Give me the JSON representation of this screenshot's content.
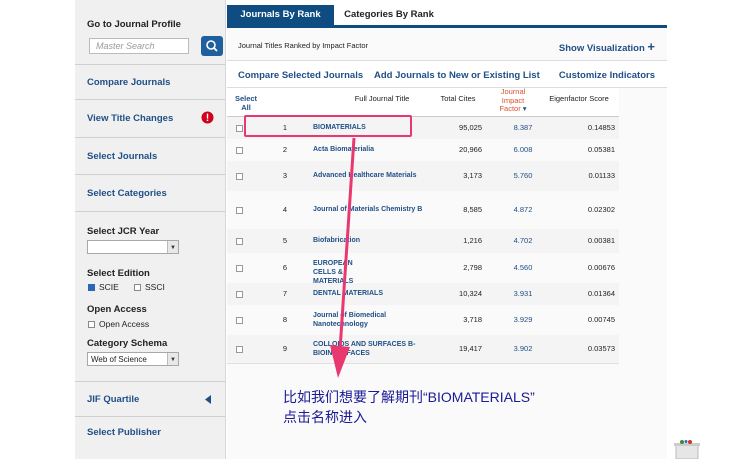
{
  "sidebar": {
    "goto_label": "Go to Journal Profile",
    "search_placeholder": "Master Search",
    "compare_journals": "Compare Journals",
    "view_title_changes": "View Title Changes",
    "select_journals": "Select Journals",
    "select_categories": "Select Categories",
    "jcr_year_label": "Select JCR Year",
    "jcr_year_value": "",
    "edition_label": "Select Edition",
    "scie": "SCIE",
    "ssci": "SSCI",
    "open_access_label": "Open Access",
    "open_access_option": "Open Access",
    "schema_label": "Category Schema",
    "schema_value": "Web of Science",
    "jif_quartile": "JIF Quartile",
    "select_publisher": "Select Publisher"
  },
  "tabs": {
    "active": "Journals By Rank",
    "other": "Categories By Rank"
  },
  "header": {
    "ranked_title": "Journal Titles Ranked by Impact Factor",
    "show_visualization": "Show Visualization",
    "compare_selected": "Compare Selected Journals",
    "add_journals": "Add Journals to New or Existing List",
    "customize": "Customize Indicators"
  },
  "table": {
    "col_select_1": "Select",
    "col_select_2": "All",
    "col_title": "Full Journal Title",
    "col_cites": "Total Cites",
    "col_jif_1": "Journal",
    "col_jif_2": "Impact",
    "col_jif_3": "Factor",
    "col_eig": "Eigenfactor Score",
    "rows": [
      {
        "rank": "1",
        "title": "BIOMATERIALS",
        "cites": "95,025",
        "jif": "8.387",
        "eig": "0.14853"
      },
      {
        "rank": "2",
        "title": "Acta Biomaterialia",
        "cites": "20,966",
        "jif": "6.008",
        "eig": "0.05381"
      },
      {
        "rank": "3",
        "title": "Advanced Healthcare Materials",
        "cites": "3,173",
        "jif": "5.760",
        "eig": "0.01133"
      },
      {
        "rank": "4",
        "title": "Journal of Materials Chemistry B",
        "cites": "8,585",
        "jif": "4.872",
        "eig": "0.02302"
      },
      {
        "rank": "5",
        "title": "Biofabrication",
        "cites": "1,216",
        "jif": "4.702",
        "eig": "0.00381"
      },
      {
        "rank": "6",
        "title": "EUROPEAN CELLS & MATERIALS",
        "cites": "2,798",
        "jif": "4.560",
        "eig": "0.00676"
      },
      {
        "rank": "7",
        "title": "DENTAL MATERIALS",
        "cites": "10,324",
        "jif": "3.931",
        "eig": "0.01364"
      },
      {
        "rank": "8",
        "title": "Journal of Biomedical Nanotechnology",
        "cites": "3,718",
        "jif": "3.929",
        "eig": "0.00745"
      },
      {
        "rank": "9",
        "title": "COLLOIDS AND SURFACES B-BIOINTERFACES",
        "cites": "19,417",
        "jif": "3.902",
        "eig": "0.03573"
      }
    ]
  },
  "annotation": {
    "line1": "比如我们想要了解期刊“BIOMATERIALS”",
    "line2": "点击名称进入"
  },
  "colors": {
    "brand": "#0f4c82",
    "link": "#1f4f86",
    "highlight": "#e8386f",
    "annotation": "#1a1a96"
  }
}
